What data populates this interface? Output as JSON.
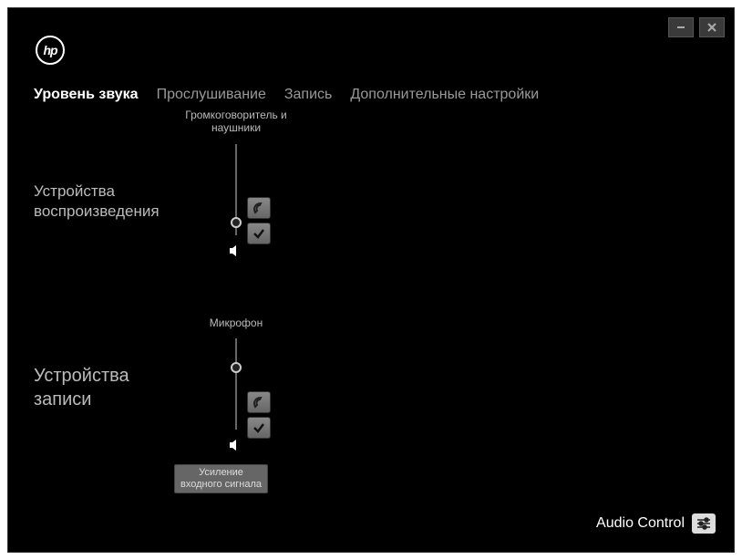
{
  "logo_text": "hp",
  "tabs": {
    "volume": "Уровень звука",
    "listening": "Прослушивание",
    "record": "Запись",
    "advanced": "Дополнительные настройки"
  },
  "sections": {
    "playback_label": "Устройства\nвоспроизведения",
    "record_label": "Устройства\nзаписи"
  },
  "sliders": {
    "speaker_label": "Громкоговоритель и\nнаушники",
    "mic_label": "Микрофон",
    "speaker_value_pct": 8,
    "mic_value_pct": 62
  },
  "boost_button": "Усиление\nвходного сигнала",
  "footer_brand": "Audio Control"
}
